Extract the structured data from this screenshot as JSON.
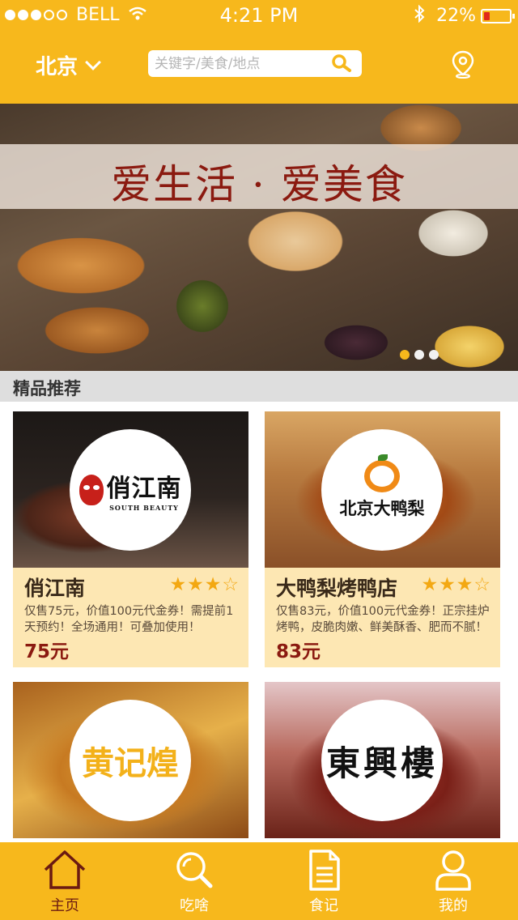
{
  "status_bar": {
    "carrier": "BELL",
    "time": "4:21 PM",
    "battery": "22%",
    "battery_level": 0.22,
    "signal_bars": 3,
    "signal_total": 5
  },
  "header": {
    "city": "北京",
    "search_placeholder": "关键字/美食/地点",
    "icons": [
      "chevron-down-icon",
      "search-icon",
      "location-pin-icon"
    ],
    "accent_color": "#f7b81c"
  },
  "banner": {
    "title": "爱生活 · 爱美食",
    "slide_count": 3,
    "active_slide": 1
  },
  "section": {
    "title": "精品推荐"
  },
  "restaurants": [
    {
      "name": "俏江南",
      "rating": 3,
      "max_rating": 4,
      "description": "仅售75元，价值100元代金券！需提前1天预约！全场通用！可叠加使用！",
      "price": "75元",
      "logo_text": "俏江南",
      "logo_subtext": "SOUTH BEAUTY"
    },
    {
      "name": "大鸭梨烤鸭店",
      "rating": 3,
      "max_rating": 4,
      "description": "仅售83元，价值100元代金券！正宗挂炉烤鸭，皮脆肉嫩、鲜美酥香、肥而不腻！",
      "price": "83元",
      "logo_text": "北京大鸭梨"
    },
    {
      "logo_text": "黄记煌"
    },
    {
      "logo_text": "東興樓"
    }
  ],
  "tabbar": {
    "items": [
      {
        "label": "主页",
        "icon": "home-icon",
        "active": true
      },
      {
        "label": "吃啥",
        "icon": "search-icon",
        "active": false
      },
      {
        "label": "食记",
        "icon": "document-icon",
        "active": false
      },
      {
        "label": "我的",
        "icon": "user-icon",
        "active": false
      }
    ],
    "active_color": "#6b1a12"
  }
}
